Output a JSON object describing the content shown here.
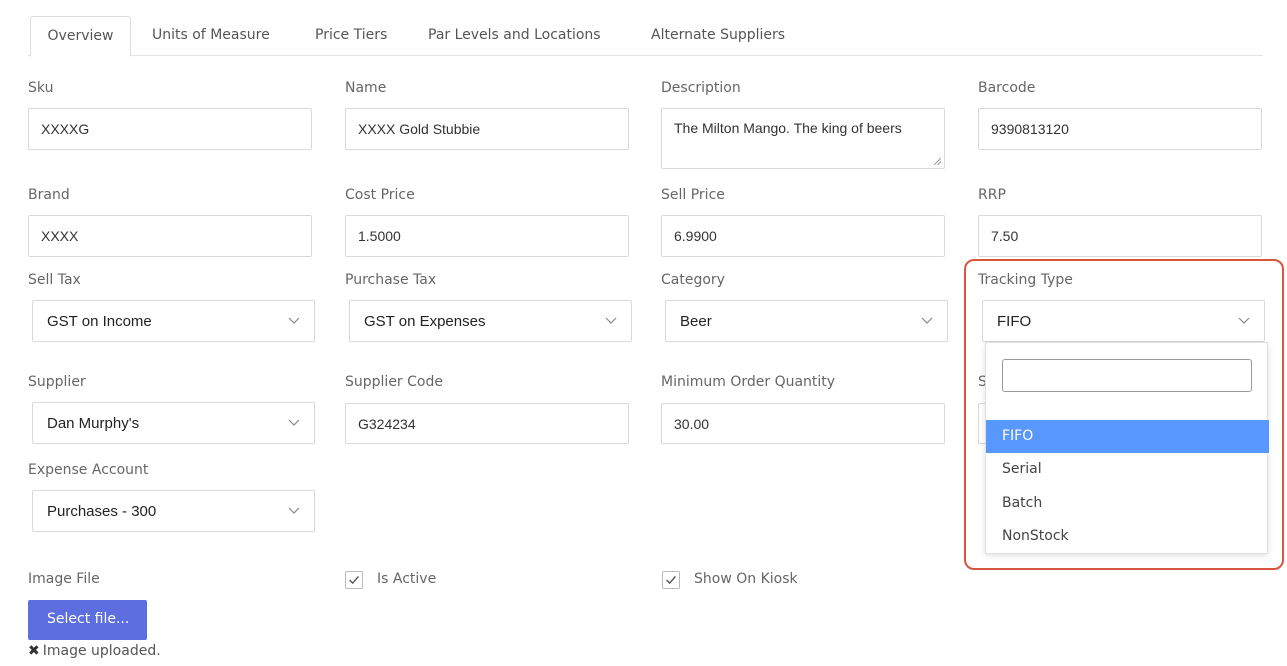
{
  "tabs": [
    {
      "label": "Overview",
      "active": true
    },
    {
      "label": "Units of Measure"
    },
    {
      "label": "Price Tiers"
    },
    {
      "label": "Par Levels and Locations"
    },
    {
      "label": "Alternate Suppliers"
    }
  ],
  "fields": {
    "sku": {
      "label": "Sku",
      "value": "XXXXG"
    },
    "name": {
      "label": "Name",
      "value": "XXXX Gold Stubbie"
    },
    "description": {
      "label": "Description",
      "value": "The Milton Mango. The king of beers"
    },
    "barcode": {
      "label": "Barcode",
      "value": "9390813120"
    },
    "brand": {
      "label": "Brand",
      "value": "XXXX"
    },
    "cost_price": {
      "label": "Cost Price",
      "value": "1.5000"
    },
    "sell_price": {
      "label": "Sell Price",
      "value": "6.9900"
    },
    "rrp": {
      "label": "RRP",
      "value": "7.50"
    },
    "sell_tax": {
      "label": "Sell Tax",
      "value": "GST on Income"
    },
    "purchase_tax": {
      "label": "Purchase Tax",
      "value": "GST on Expenses"
    },
    "category": {
      "label": "Category",
      "value": "Beer"
    },
    "tracking_type": {
      "label": "Tracking Type",
      "value": "FIFO"
    },
    "supplier": {
      "label": "Supplier",
      "value": "Dan Murphy's"
    },
    "supplier_code": {
      "label": "Supplier Code",
      "value": "G324234"
    },
    "min_order_qty": {
      "label": "Minimum Order Quantity",
      "value": "30.00"
    },
    "expense_account": {
      "label": "Expense Account",
      "value": "Purchases - 300"
    },
    "image_file": {
      "label": "Image File"
    }
  },
  "hidden_label_fragment": "S",
  "tracking_dropdown": {
    "search_value": "",
    "options": [
      "FIFO",
      "Serial",
      "Batch",
      "NonStock"
    ],
    "selected": "FIFO"
  },
  "checkboxes": {
    "is_active": {
      "label": "Is Active",
      "checked": true
    },
    "show_on_kiosk": {
      "label": "Show On Kiosk",
      "checked": true
    }
  },
  "buttons": {
    "select_file": "Select file..."
  },
  "upload_status": "Image uploaded.",
  "colors": {
    "primary_button": "#5c6ee0",
    "dropdown_selected": "#5897fb",
    "annotation_border": "#d8563f"
  }
}
